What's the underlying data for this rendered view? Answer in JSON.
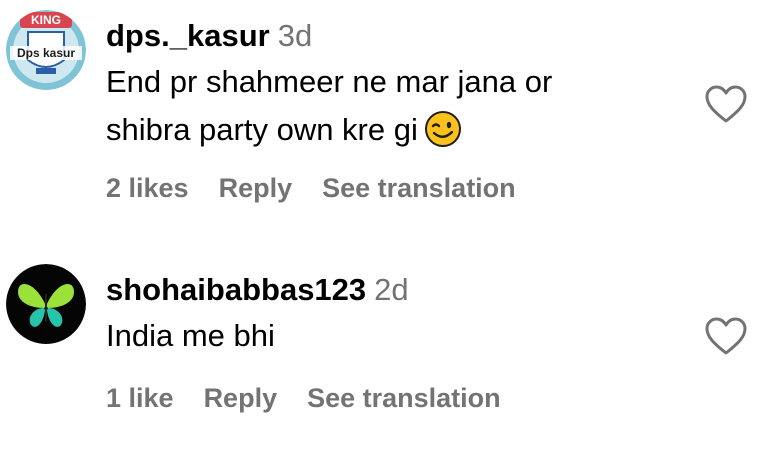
{
  "comments": [
    {
      "username": "dps._kasur",
      "time": "3d",
      "text_line1": "End pr shahmeer ne mar jana or",
      "text_line2": "shibra party own kre gi",
      "likes": "2 likes",
      "reply": "Reply",
      "translate": "See translation",
      "avatar_text_top": "KING",
      "avatar_text_main": "Dps kasur",
      "emoji": "winking-face"
    },
    {
      "username": "shohaibabbas123",
      "time": "2d",
      "text_line1": "India me bhi",
      "likes": "1 like",
      "reply": "Reply",
      "translate": "See translation",
      "emoji": ""
    }
  ],
  "colors": {
    "secondary_text": "#737373",
    "primary_text": "#000000",
    "heart_stroke": "#737373"
  }
}
